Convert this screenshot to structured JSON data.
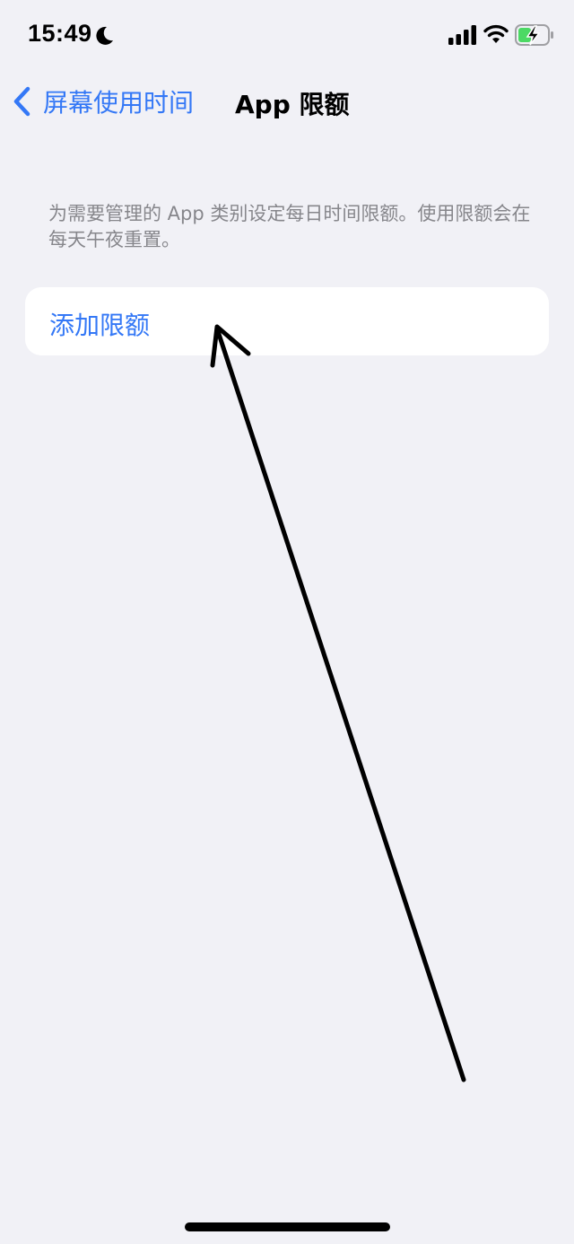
{
  "status_bar": {
    "time": "15:49",
    "focus_icon": "moon-icon",
    "signal_icon": "cellular-signal-icon",
    "wifi_icon": "wifi-icon",
    "battery_icon": "battery-charging-icon"
  },
  "nav": {
    "back_label": "屏幕使用时间",
    "title": "App 限额"
  },
  "description": "为需要管理的 App 类别设定每日时间限额。使用限额会在每天午夜重置。",
  "add_limit": {
    "label": "添加限额"
  },
  "colors": {
    "accent": "#3478f6",
    "background": "#f1f1f6",
    "cell_background": "#ffffff",
    "secondary_text": "#86868b",
    "battery_green": "#4cd964"
  }
}
